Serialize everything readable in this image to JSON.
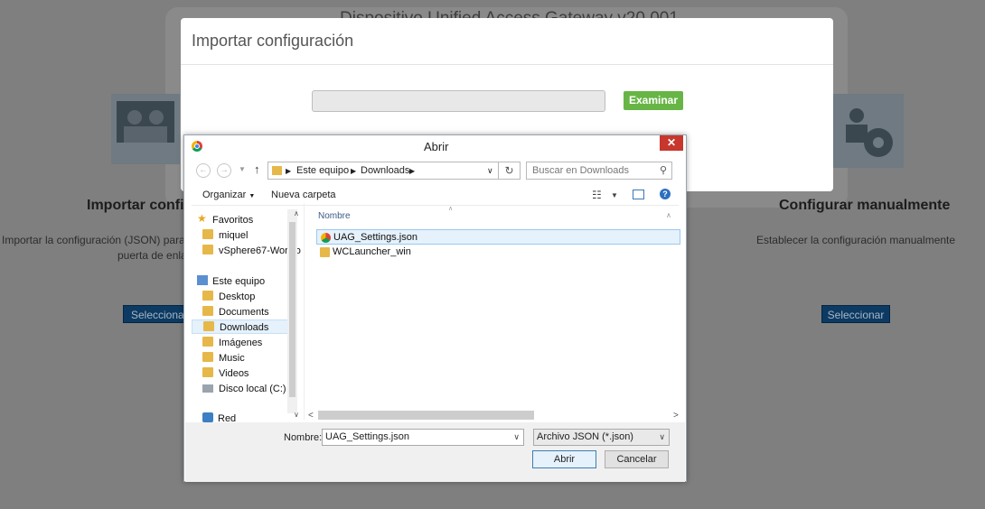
{
  "background": {
    "title": "Dispositivo Unified Access Gateway v20.001",
    "import_heading": "Importar configuración",
    "import_desc_1": "Importar la configuración (JSON) para la",
    "import_desc_2": "puerta de enlace",
    "manual_heading": "Configurar manualmente",
    "manual_desc": "Establecer la configuración manualmente",
    "select_left_label": "Seleccionar",
    "select_right_label": "Seleccionar"
  },
  "modal": {
    "title": "Importar configuración",
    "file_path_value": "",
    "browse_label": "Examinar"
  },
  "dialog": {
    "title": "Abrir",
    "close_glyph": "✕",
    "breadcrumb": [
      "Este equipo",
      "Downloads"
    ],
    "search_placeholder": "Buscar en Downloads",
    "toolbar": {
      "organize_label": "Organizar",
      "new_folder_label": "Nueva carpeta"
    },
    "nav_items": [
      {
        "label": "Favoritos",
        "icon": "star-icon"
      },
      {
        "label": "miquel",
        "icon": "folder-icon"
      },
      {
        "label": "vSphere67-Worklo",
        "icon": "folder-icon"
      },
      {
        "label": "Este equipo",
        "icon": "computer-icon"
      },
      {
        "label": "Desktop",
        "icon": "folder-icon"
      },
      {
        "label": "Documents",
        "icon": "folder-icon"
      },
      {
        "label": "Downloads",
        "icon": "folder-icon"
      },
      {
        "label": "Imágenes",
        "icon": "folder-icon"
      },
      {
        "label": "Music",
        "icon": "folder-icon"
      },
      {
        "label": "Videos",
        "icon": "folder-icon"
      },
      {
        "label": "Disco local (C:)",
        "icon": "drive-icon"
      },
      {
        "label": "Red",
        "icon": "network-icon"
      }
    ],
    "column_name": "Nombre",
    "files": [
      {
        "name": "UAG_Settings.json",
        "icon": "chrome-icon",
        "selected": true
      },
      {
        "name": "WCLauncher_win",
        "icon": "folder-icon",
        "selected": false
      }
    ],
    "filename_label": "Nombre:",
    "filename_value": "UAG_Settings.json",
    "filter_value": "Archivo JSON (*.json)",
    "open_label": "Abrir",
    "cancel_label": "Cancelar"
  }
}
